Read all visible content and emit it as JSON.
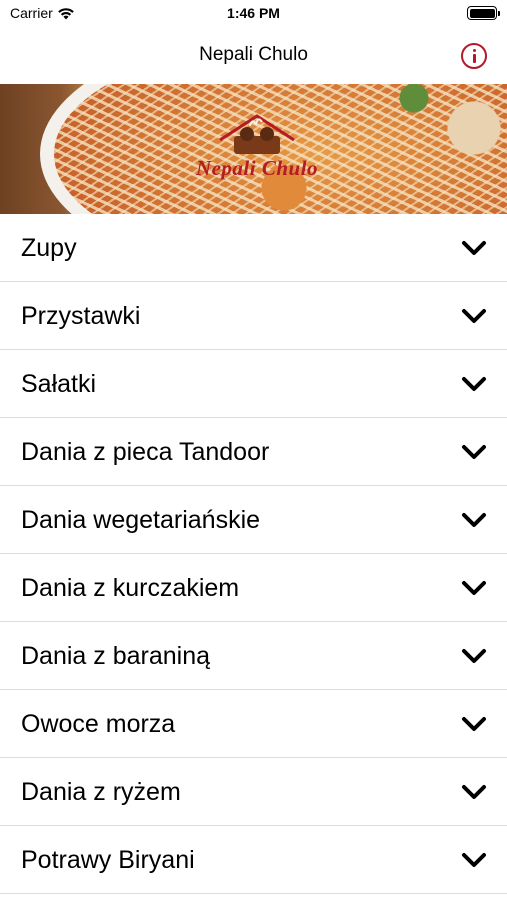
{
  "status_bar": {
    "carrier": "Carrier",
    "time": "1:46 PM",
    "icons": [
      "wifi-icon",
      "battery-icon"
    ]
  },
  "nav": {
    "title": "Nepali Chulo",
    "info_icon": "info-circle-icon",
    "accent_color": "#b3192b"
  },
  "banner": {
    "logo_text": "Nepali Chulo"
  },
  "menu": {
    "items": [
      {
        "label": "Zupy"
      },
      {
        "label": "Przystawki"
      },
      {
        "label": "Sałatki"
      },
      {
        "label": "Dania z pieca Tandoor"
      },
      {
        "label": "Dania wegetariańskie"
      },
      {
        "label": "Dania z kurczakiem"
      },
      {
        "label": "Dania z baraniną"
      },
      {
        "label": "Owoce morza"
      },
      {
        "label": "Dania z ryżem"
      },
      {
        "label": "Potrawy Biryani"
      }
    ],
    "expand_icon": "chevron-down-icon"
  }
}
